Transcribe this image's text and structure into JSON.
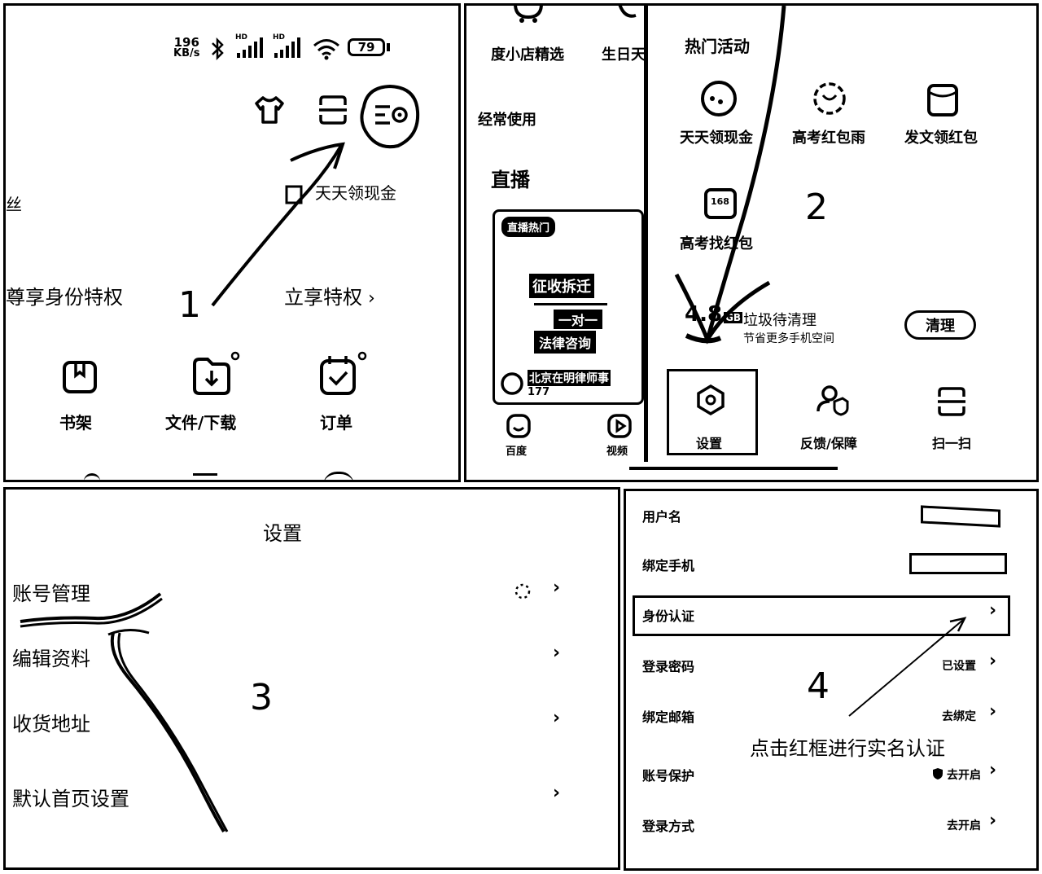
{
  "panel1": {
    "status": {
      "speed_value": "196",
      "speed_unit": "KB/s",
      "hd1": "HD",
      "hd2": "HD",
      "battery": "79"
    },
    "left_cut_text": "丝",
    "promo_label": "天天领现金",
    "privilege_left": "尊享身份特权",
    "privilege_right": "立享特权",
    "step_number": "1",
    "tools": [
      {
        "label": "书架"
      },
      {
        "label": "文件/下载"
      },
      {
        "label": "订单"
      }
    ]
  },
  "panel2": {
    "left_col": {
      "items": [
        "度小店精选",
        "生日天"
      ],
      "frequent": "经常使用",
      "live": "直播",
      "card_badge": "直播热门",
      "card_title_1": "征收拆迁",
      "card_title_2": "一对一",
      "card_title_3": "法律咨询",
      "card_footer": "北京在明律师事",
      "card_count": "177",
      "tabs": [
        "百度",
        "视频"
      ]
    },
    "hot_activities": "热门活动",
    "activities": [
      {
        "label": "天天领现金"
      },
      {
        "label": "高考红包雨"
      },
      {
        "label": "发文领红包"
      },
      {
        "label": "高考找红包"
      }
    ],
    "cleanup_size": "4.8",
    "cleanup_unit": "GB",
    "cleanup_title": "垃圾待清理",
    "cleanup_subtitle": "节省更多手机空间",
    "cleanup_button": "清理",
    "step_number": "2",
    "bottom_tools": [
      {
        "label": "设置"
      },
      {
        "label": "反馈/保障"
      },
      {
        "label": "扫一扫"
      }
    ]
  },
  "panel3": {
    "title": "设置",
    "rows": [
      {
        "label": "账号管理"
      },
      {
        "label": "编辑资料"
      },
      {
        "label": "收货地址"
      },
      {
        "label": "默认首页设置"
      }
    ],
    "step_number": "3"
  },
  "panel4": {
    "rows": [
      {
        "label": "用户名",
        "value": ""
      },
      {
        "label": "绑定手机",
        "value": ""
      },
      {
        "label": "身份认证",
        "value": ""
      },
      {
        "label": "登录密码",
        "value": "已设置"
      },
      {
        "label": "绑定邮箱",
        "value": "去绑定"
      },
      {
        "label": "账号保护",
        "value": "去开启"
      },
      {
        "label": "登录方式",
        "value": "去开启"
      }
    ],
    "step_number": "4",
    "instruction": "点击红框进行实名认证"
  }
}
